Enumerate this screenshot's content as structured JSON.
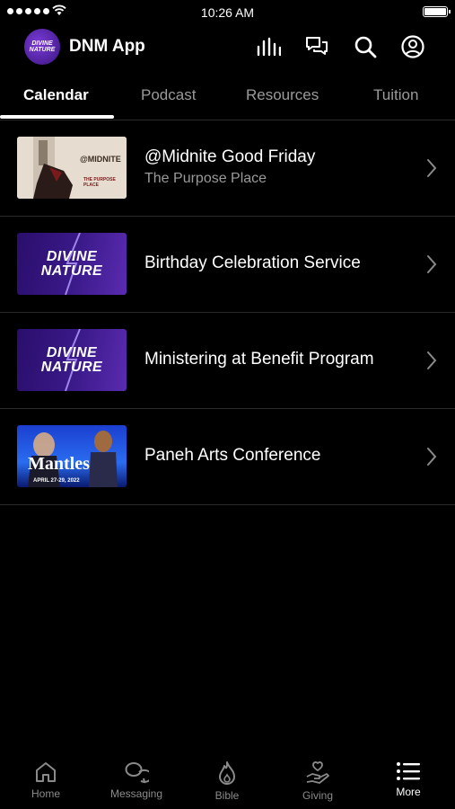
{
  "status_bar": {
    "time": "10:26 AM"
  },
  "header": {
    "title": "DNM App",
    "logo_text": "DIVINE NATURE"
  },
  "tabs": [
    {
      "label": "Calendar",
      "active": true
    },
    {
      "label": "Podcast",
      "active": false
    },
    {
      "label": "Resources",
      "active": false
    },
    {
      "label": "Tuition",
      "active": false
    }
  ],
  "events": [
    {
      "title": "@Midnite Good Friday",
      "subtitle": "The Purpose Place",
      "thumb_text": "@MIDNITE",
      "thumb_sub": "THE PURPOSE PLACE"
    },
    {
      "title": "Birthday Celebration Service",
      "thumb_text": "DIVINE NATURE"
    },
    {
      "title": "Ministering at Benefit Program",
      "thumb_text": "DIVINE NATURE"
    },
    {
      "title": "Paneh Arts Conference",
      "thumb_text": "Mantles",
      "thumb_sub": "APRIL 27-29, 2022"
    }
  ],
  "bottom_nav": [
    {
      "label": "Home",
      "icon": "home-icon"
    },
    {
      "label": "Messaging",
      "icon": "messaging-icon"
    },
    {
      "label": "Bible",
      "icon": "bible-flame-icon"
    },
    {
      "label": "Giving",
      "icon": "giving-hand-icon"
    },
    {
      "label": "More",
      "icon": "more-list-icon",
      "active": true
    }
  ],
  "colors": {
    "background": "#000000",
    "accent_purple": "#3b1a8a",
    "inactive": "#9a9a9a"
  }
}
